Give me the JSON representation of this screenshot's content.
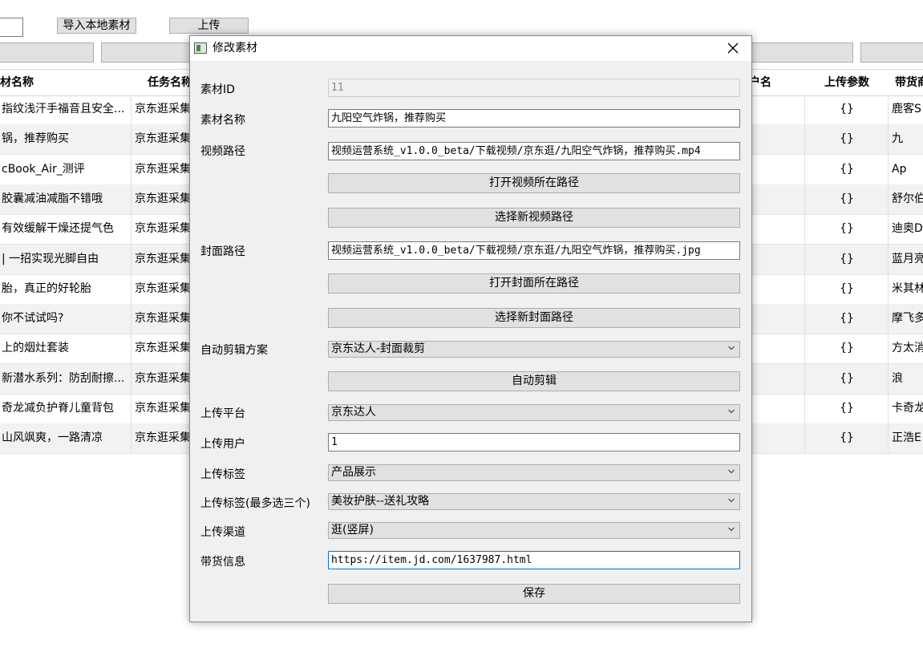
{
  "toolbar": {
    "import_label": "导入本地素材",
    "upload_label": "上传"
  },
  "table": {
    "headers": [
      "材名称",
      "任务名称",
      "户名",
      "上传参数",
      "带货商"
    ],
    "rows": [
      {
        "name": "指纹浅汗手福音且安全...",
        "task": "京东逛采集",
        "params": "{}",
        "goods": "鹿客S"
      },
      {
        "name": "锅，推荐购买",
        "task": "京东逛采集",
        "params": "{}",
        "goods": "九"
      },
      {
        "name": "cBook_Air_测评",
        "task": "京东逛采集",
        "params": "{}",
        "goods": "Ap"
      },
      {
        "name": "胶囊减油减脂不错哦",
        "task": "京东逛采集",
        "params": "{}",
        "goods": "舒尔伯"
      },
      {
        "name": "有效缓解干燥还提气色",
        "task": "京东逛采集",
        "params": "{}",
        "goods": "迪奥D"
      },
      {
        "name": "| 一招实现光脚自由",
        "task": "京东逛采集",
        "params": "{}",
        "goods": "蓝月亮"
      },
      {
        "name": "胎，真正的好轮胎",
        "task": "京东逛采集",
        "params": "{}",
        "goods": "米其林"
      },
      {
        "name": "你不试试吗?",
        "task": "京东逛采集",
        "params": "{}",
        "goods": "摩飞多"
      },
      {
        "name": "上的烟灶套装",
        "task": "京东逛采集",
        "params": "{}",
        "goods": "方太消"
      },
      {
        "name": "新潜水系列：防刮耐擦...",
        "task": "京东逛采集",
        "params": "{}",
        "goods": "浪"
      },
      {
        "name": "奇龙减负护脊儿童背包",
        "task": "京东逛采集",
        "params": "{}",
        "goods": "卡奇龙"
      },
      {
        "name": "山风飒爽，一路清凉",
        "task": "京东逛采集",
        "params": "{}",
        "goods": "正浩E"
      }
    ]
  },
  "dialog": {
    "title": "修改素材",
    "material_id_label": "素材ID",
    "material_id_value": "11",
    "material_name_label": "素材名称",
    "material_name_value": "九阳空气炸锅，推荐购买",
    "video_path_label": "视频路径",
    "video_path_value": "视频运营系统_v1.0.0_beta/下载视频/京东逛/九阳空气炸锅，推荐购买.mp4",
    "open_video_dir_label": "打开视频所在路径",
    "choose_video_label": "选择新视频路径",
    "cover_path_label": "封面路径",
    "cover_path_value": "视频运营系统_v1.0.0_beta/下载视频/京东逛/九阳空气炸锅，推荐购买.jpg",
    "open_cover_dir_label": "打开封面所在路径",
    "choose_cover_label": "选择新封面路径",
    "auto_edit_scheme_label": "自动剪辑方案",
    "auto_edit_scheme_value": "京东达人-封面裁剪",
    "auto_edit_label": "自动剪辑",
    "platform_label": "上传平台",
    "platform_value": "京东达人",
    "user_label": "上传用户",
    "user_value": "1",
    "tag_label": "上传标签",
    "tag_value": "产品展示",
    "tag_multi_label": "上传标签(最多选三个)",
    "tag_multi_value": "美妆护肤--送礼攻略",
    "channel_label": "上传渠道",
    "channel_value": "逛(竖屏)",
    "goods_label": "带货信息",
    "goods_value": "https://item.jd.com/1637987.html",
    "save_label": "保存"
  }
}
